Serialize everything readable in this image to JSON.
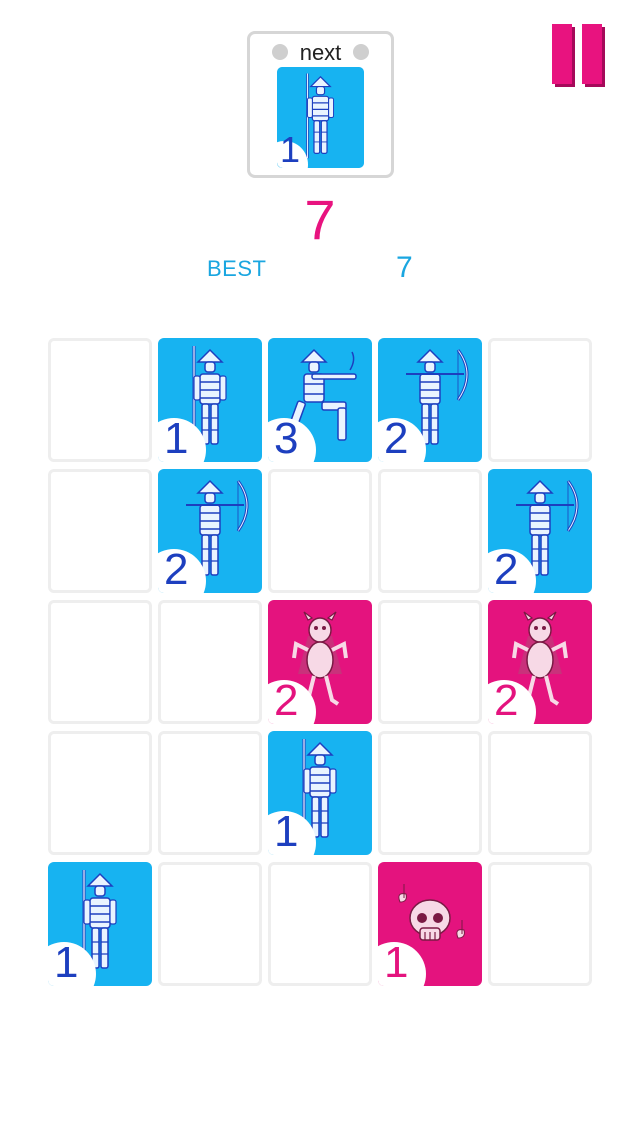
{
  "header": {
    "next_label": "next",
    "next_piece": {
      "kind": "spearman",
      "value": "1",
      "color": "blue"
    }
  },
  "score": {
    "current": "7",
    "best_label": "BEST",
    "best_value": "7"
  },
  "pause_icon": "pause-icon",
  "colors": {
    "blue_tile": "#17b3f1",
    "pink_tile": "#e4137e",
    "score": "#e8137f",
    "best": "#1aa6e0",
    "blue_number": "#1d3fbf"
  },
  "board": {
    "cols": 5,
    "rows": 5,
    "tiles": [
      {
        "row": 0,
        "col": 1,
        "kind": "spearman",
        "value": "1",
        "color": "blue"
      },
      {
        "row": 0,
        "col": 2,
        "kind": "gunner",
        "value": "3",
        "color": "blue"
      },
      {
        "row": 0,
        "col": 3,
        "kind": "archer",
        "value": "2",
        "color": "blue"
      },
      {
        "row": 1,
        "col": 1,
        "kind": "archer",
        "value": "2",
        "color": "blue"
      },
      {
        "row": 1,
        "col": 4,
        "kind": "archer",
        "value": "2",
        "color": "blue"
      },
      {
        "row": 2,
        "col": 2,
        "kind": "demon",
        "value": "2",
        "color": "pink"
      },
      {
        "row": 2,
        "col": 4,
        "kind": "demon",
        "value": "2",
        "color": "pink"
      },
      {
        "row": 3,
        "col": 2,
        "kind": "spearman",
        "value": "1",
        "color": "blue"
      },
      {
        "row": 4,
        "col": 0,
        "kind": "spearman",
        "value": "1",
        "color": "blue"
      },
      {
        "row": 4,
        "col": 3,
        "kind": "skull",
        "value": "1",
        "color": "pink"
      }
    ]
  }
}
